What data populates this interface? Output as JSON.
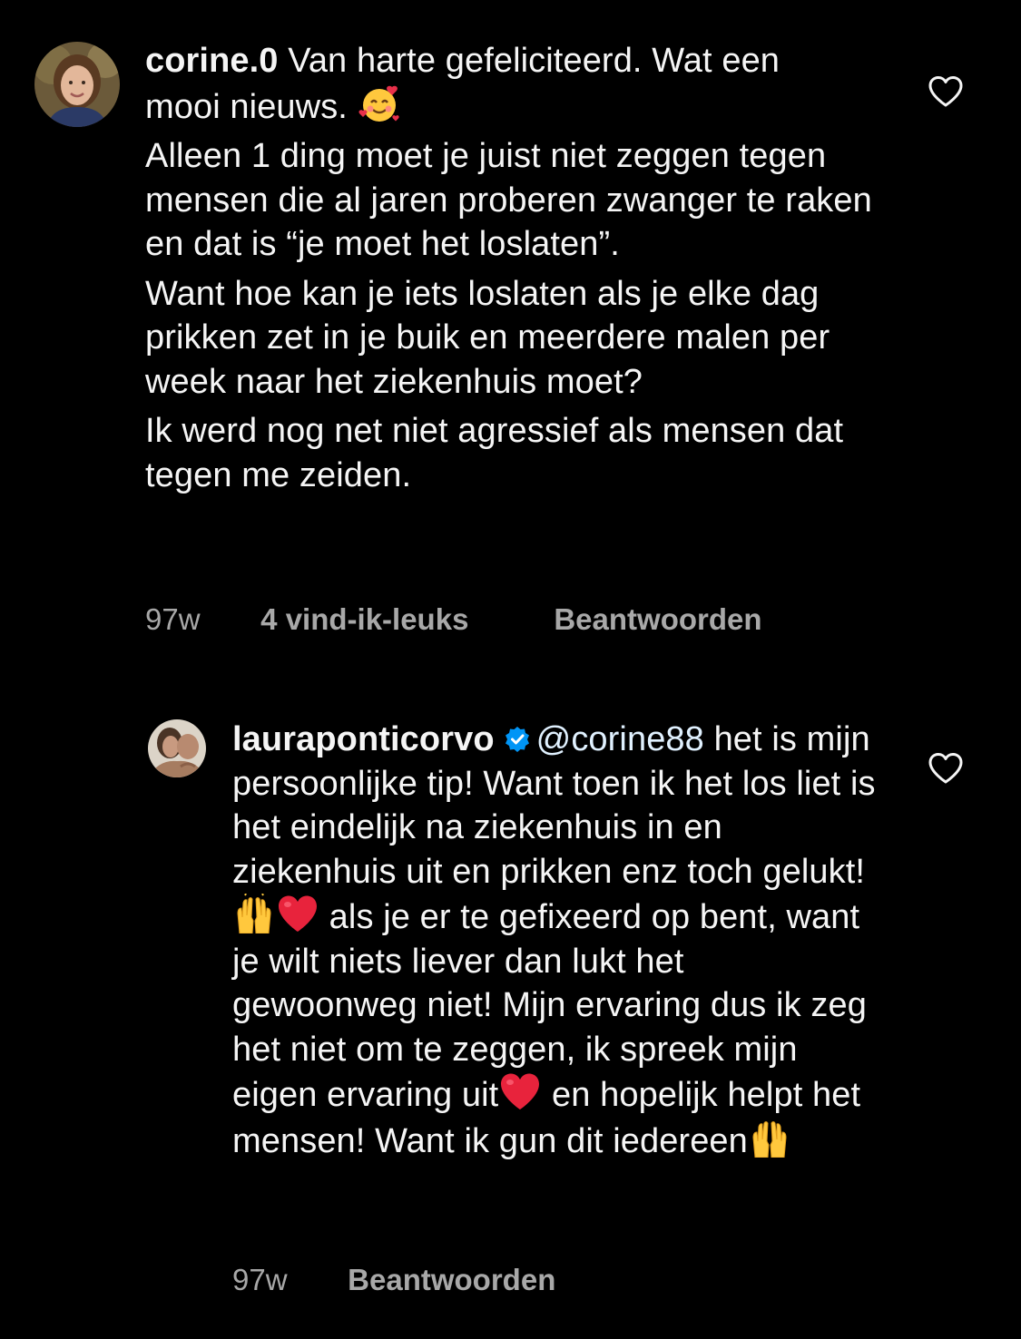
{
  "comments": [
    {
      "username": "corine.0",
      "line_1a": "Van harte gefeliciteerd. Wat een",
      "line_1b": "mooi nieuws.",
      "para_2": "Alleen 1 ding moet je juist niet zeggen tegen mensen die al jaren proberen zwanger te raken en dat is “je moet het loslaten”.",
      "para_3": "Want hoe kan je iets loslaten als je elke dag prikken zet in je buik en meerdere malen per week naar het ziekenhuis moet?",
      "para_4": "Ik werd nog net niet agressief als mensen dat tegen me zeiden.",
      "time": "97w",
      "likes": "4 vind-ik-leuks",
      "reply_label": "Beantwoorden"
    },
    {
      "username": "lauraponticorvo",
      "mention": "@corine88",
      "text_1": "het is mijn persoonlijke tip! Want toen ik het los liet is het eindelijk na ziekenhuis in en ziekenhuis uit en prikken enz toch gelukt!",
      "text_2": "als je er te gefixeerd op bent, want je wilt niets liever dan lukt het gewoonweg niet! Mijn ervaring dus ik zeg het niet om te zeggen, ik spreek mijn eigen ervaring uit",
      "text_3": "en hopelijk helpt het mensen! Want ik gun dit iedereen",
      "time": "97w",
      "reply_label": "Beantwoorden"
    }
  ],
  "icons": {
    "like": "heart-outline-icon",
    "verified": "verified-badge-icon",
    "emoji_smile": "smiling-face-with-hearts-emoji",
    "emoji_hands": "raising-hands-emoji",
    "emoji_heart": "red-heart-emoji"
  },
  "colors": {
    "background": "#000000",
    "text": "#f5f5f5",
    "meta": "#a8a8a8",
    "verified": "#0095f6",
    "mention": "#e0f1ff"
  }
}
